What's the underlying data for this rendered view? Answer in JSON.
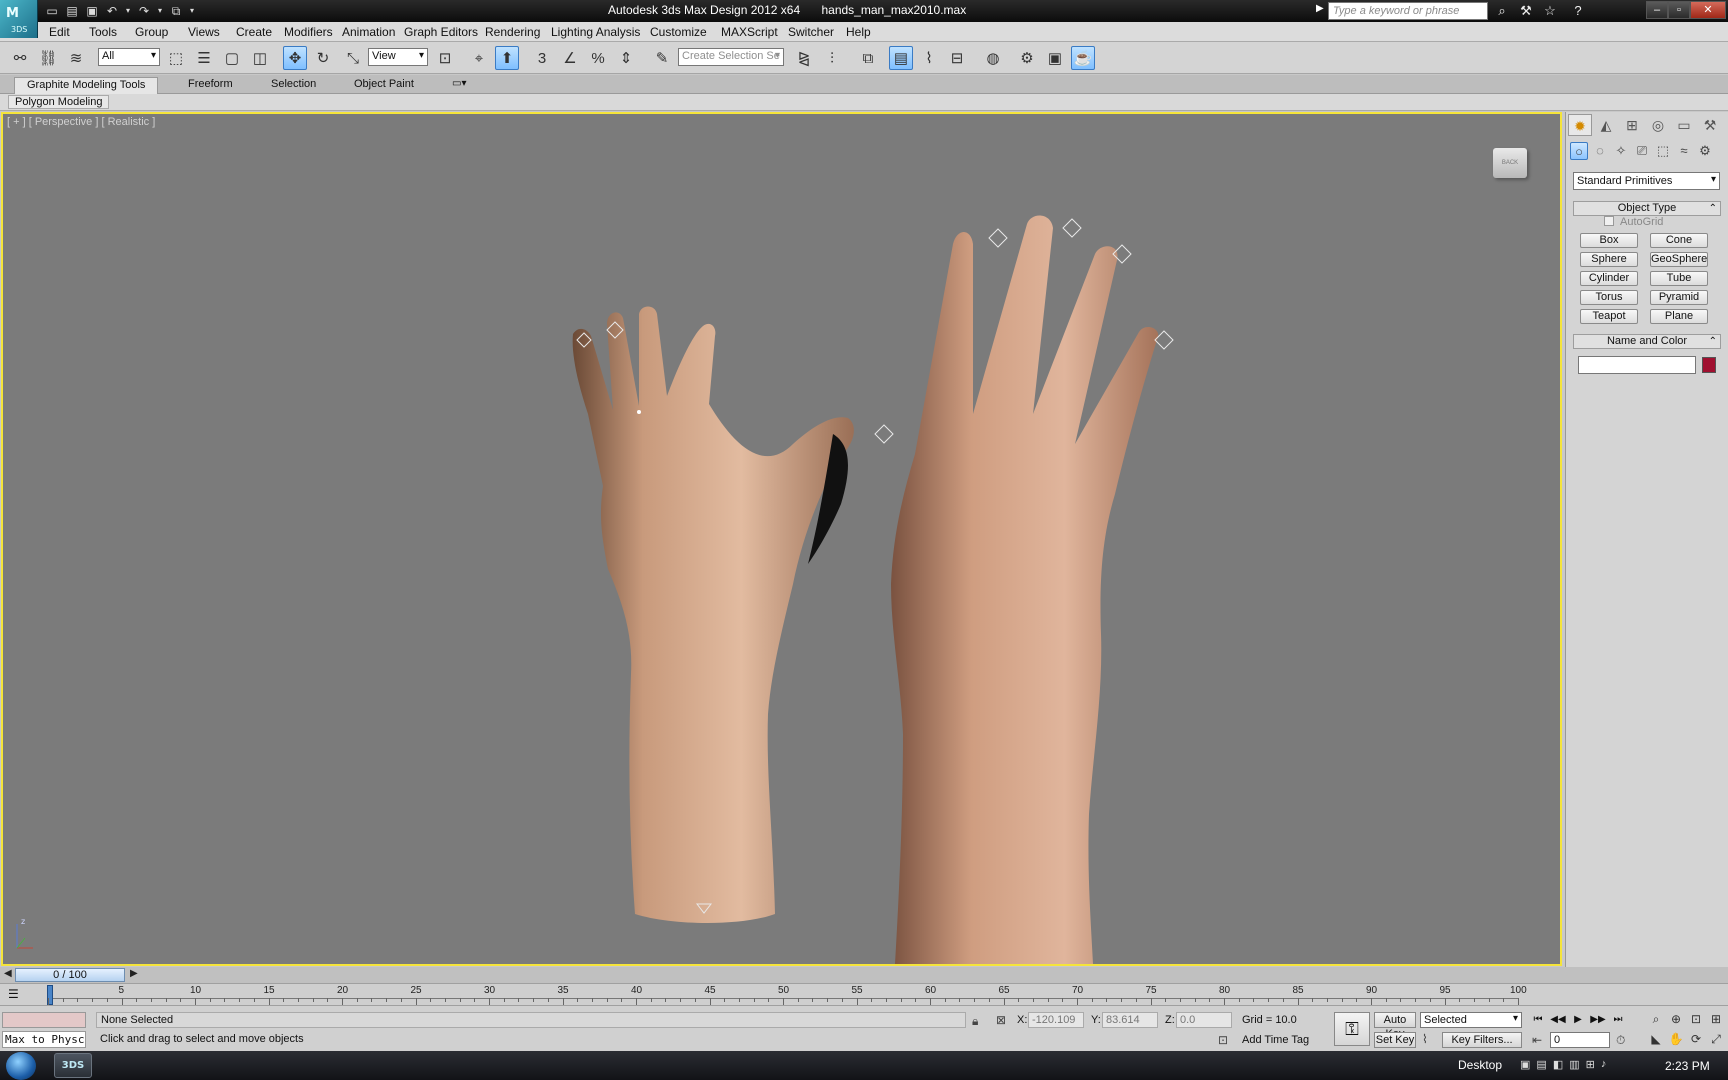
{
  "app": {
    "title": "Autodesk 3ds Max Design 2012 x64",
    "filename": "hands_man_max2010.max",
    "logo_text": "3DS",
    "search_placeholder": "Type a keyword or phrase",
    "help_label": "?",
    "window_buttons": [
      "–",
      "▫",
      "✕"
    ]
  },
  "menu": [
    "Edit",
    "Tools",
    "Group",
    "Views",
    "Create",
    "Modifiers",
    "Animation",
    "Graph Editors",
    "Rendering",
    "Lighting Analysis",
    "Customize",
    "MAXScript",
    "Switcher",
    "Help"
  ],
  "toolbar": {
    "selection_filter": "All",
    "reference_coord": "View",
    "named_selection_placeholder": "Create Selection Se",
    "angle_snap_label": "3",
    "percent_snap_label": "%"
  },
  "ribbon": {
    "tabs": [
      "Graphite Modeling Tools",
      "Freeform",
      "Selection",
      "Object Paint"
    ],
    "active_tab": 0,
    "sub_panel": "Polygon Modeling"
  },
  "viewport": {
    "label": "[ + ] [ Perspective ] [ Realistic ]",
    "axis_label": "z",
    "border_color": "#f5e43a",
    "background": "#7b7b7b",
    "viewcube_label": "BACK"
  },
  "command_panel": {
    "category": "Standard Primitives",
    "object_type_title": "Object Type",
    "autogrid_label": "AutoGrid",
    "primitives": [
      "Box",
      "Cone",
      "Sphere",
      "GeoSphere",
      "Cylinder",
      "Tube",
      "Torus",
      "Pyramid",
      "Teapot",
      "Plane"
    ],
    "name_color_title": "Name and Color",
    "object_color": "#a01030"
  },
  "time": {
    "slider_label": "0 / 100",
    "ticks": [
      5,
      10,
      15,
      20,
      25,
      30,
      35,
      40,
      45,
      50,
      55,
      60,
      65,
      70,
      75,
      80,
      85,
      90,
      95,
      100
    ]
  },
  "status": {
    "maxscript_listener": "Max to Physc",
    "selection": "None Selected",
    "prompt": "Click and drag to select and move objects",
    "x_label": "X:",
    "x_value": "-120.109",
    "y_label": "Y:",
    "y_value": "83.614",
    "z_label": "Z:",
    "z_value": "0.0",
    "grid": "Grid = 10.0",
    "add_time_tag": "Add Time Tag",
    "auto_key": "Auto Key",
    "set_key": "Set Key",
    "key_mode": "Selected",
    "key_filters": "Key Filters...",
    "current_frame": "0"
  },
  "taskbar": {
    "app_label": "3DS",
    "desktop_label": "Desktop",
    "clock": "2:23 PM"
  }
}
